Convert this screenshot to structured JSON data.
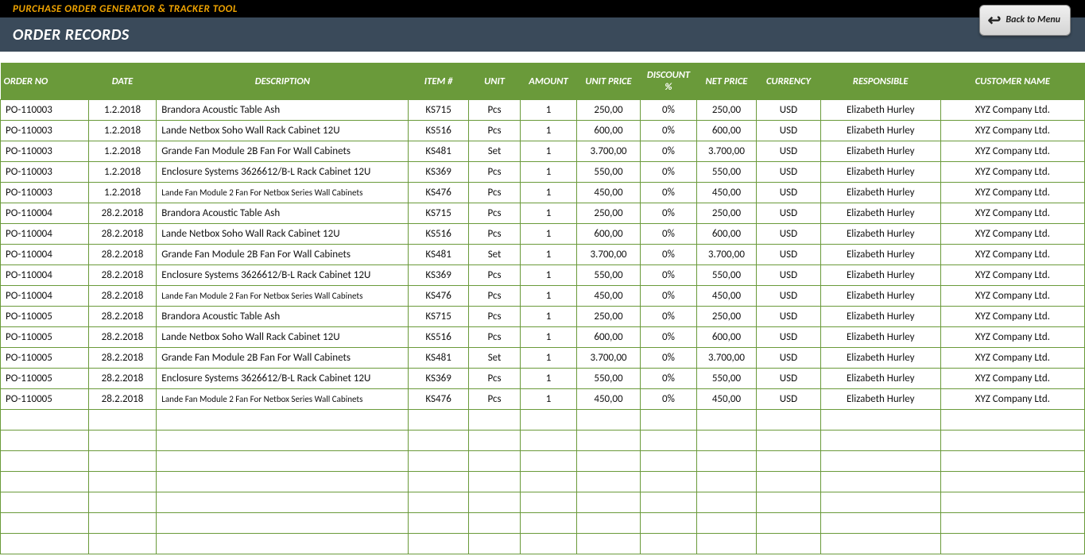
{
  "header": {
    "app_title": "PURCHASE ORDER GENERATOR & TRACKER TOOL",
    "page_title": "ORDER RECORDS",
    "back_label": "Back to Menu"
  },
  "columns": [
    "ORDER NO",
    "DATE",
    "DESCRIPTION",
    "ITEM #",
    "UNIT",
    "AMOUNT",
    "UNIT PRICE",
    "DISCOUNT %",
    "NET PRICE",
    "CURRENCY",
    "RESPONSIBLE",
    "CUSTOMER NAME"
  ],
  "rows": [
    {
      "order": "PO-110003",
      "date": "1.2.2018",
      "desc": "Brandora Acoustic Table Ash",
      "item": "KS715",
      "unit": "Pcs",
      "amount": "1",
      "uprice": "250,00",
      "disc": "0%",
      "nprice": "250,00",
      "curr": "USD",
      "resp": "Elizabeth Hurley",
      "cust": "XYZ Company Ltd.",
      "small": false
    },
    {
      "order": "PO-110003",
      "date": "1.2.2018",
      "desc": "Lande Netbox Soho Wall Rack Cabinet 12U",
      "item": "KS516",
      "unit": "Pcs",
      "amount": "1",
      "uprice": "600,00",
      "disc": "0%",
      "nprice": "600,00",
      "curr": "USD",
      "resp": "Elizabeth Hurley",
      "cust": "XYZ Company Ltd.",
      "small": false
    },
    {
      "order": "PO-110003",
      "date": "1.2.2018",
      "desc": "Grande Fan Module 2B Fan For Wall Cabinets",
      "item": "KS481",
      "unit": "Set",
      "amount": "1",
      "uprice": "3.700,00",
      "disc": "0%",
      "nprice": "3.700,00",
      "curr": "USD",
      "resp": "Elizabeth Hurley",
      "cust": "XYZ Company Ltd.",
      "small": false
    },
    {
      "order": "PO-110003",
      "date": "1.2.2018",
      "desc": "Enclosure Systems 3626612/B-L Rack Cabinet 12U",
      "item": "KS369",
      "unit": "Pcs",
      "amount": "1",
      "uprice": "550,00",
      "disc": "0%",
      "nprice": "550,00",
      "curr": "USD",
      "resp": "Elizabeth Hurley",
      "cust": "XYZ Company Ltd.",
      "small": false
    },
    {
      "order": "PO-110003",
      "date": "1.2.2018",
      "desc": "Lande Fan Module 2 Fan For Netbox Series Wall Cabinets",
      "item": "KS476",
      "unit": "Pcs",
      "amount": "1",
      "uprice": "450,00",
      "disc": "0%",
      "nprice": "450,00",
      "curr": "USD",
      "resp": "Elizabeth Hurley",
      "cust": "XYZ Company Ltd.",
      "small": true
    },
    {
      "order": "PO-110004",
      "date": "28.2.2018",
      "desc": "Brandora Acoustic Table Ash",
      "item": "KS715",
      "unit": "Pcs",
      "amount": "1",
      "uprice": "250,00",
      "disc": "0%",
      "nprice": "250,00",
      "curr": "USD",
      "resp": "Elizabeth Hurley",
      "cust": "XYZ Company Ltd.",
      "small": false
    },
    {
      "order": "PO-110004",
      "date": "28.2.2018",
      "desc": "Lande Netbox Soho Wall Rack Cabinet 12U",
      "item": "KS516",
      "unit": "Pcs",
      "amount": "1",
      "uprice": "600,00",
      "disc": "0%",
      "nprice": "600,00",
      "curr": "USD",
      "resp": "Elizabeth Hurley",
      "cust": "XYZ Company Ltd.",
      "small": false
    },
    {
      "order": "PO-110004",
      "date": "28.2.2018",
      "desc": "Grande Fan Module 2B Fan For Wall Cabinets",
      "item": "KS481",
      "unit": "Set",
      "amount": "1",
      "uprice": "3.700,00",
      "disc": "0%",
      "nprice": "3.700,00",
      "curr": "USD",
      "resp": "Elizabeth Hurley",
      "cust": "XYZ Company Ltd.",
      "small": false
    },
    {
      "order": "PO-110004",
      "date": "28.2.2018",
      "desc": "Enclosure Systems 3626612/B-L Rack Cabinet 12U",
      "item": "KS369",
      "unit": "Pcs",
      "amount": "1",
      "uprice": "550,00",
      "disc": "0%",
      "nprice": "550,00",
      "curr": "USD",
      "resp": "Elizabeth Hurley",
      "cust": "XYZ Company Ltd.",
      "small": false
    },
    {
      "order": "PO-110004",
      "date": "28.2.2018",
      "desc": "Lande Fan Module 2 Fan For Netbox Series Wall Cabinets",
      "item": "KS476",
      "unit": "Pcs",
      "amount": "1",
      "uprice": "450,00",
      "disc": "0%",
      "nprice": "450,00",
      "curr": "USD",
      "resp": "Elizabeth Hurley",
      "cust": "XYZ Company Ltd.",
      "small": true
    },
    {
      "order": "PO-110005",
      "date": "28.2.2018",
      "desc": "Brandora Acoustic Table Ash",
      "item": "KS715",
      "unit": "Pcs",
      "amount": "1",
      "uprice": "250,00",
      "disc": "0%",
      "nprice": "250,00",
      "curr": "USD",
      "resp": "Elizabeth Hurley",
      "cust": "XYZ Company Ltd.",
      "small": false
    },
    {
      "order": "PO-110005",
      "date": "28.2.2018",
      "desc": "Lande Netbox Soho Wall Rack Cabinet 12U",
      "item": "KS516",
      "unit": "Pcs",
      "amount": "1",
      "uprice": "600,00",
      "disc": "0%",
      "nprice": "600,00",
      "curr": "USD",
      "resp": "Elizabeth Hurley",
      "cust": "XYZ Company Ltd.",
      "small": false
    },
    {
      "order": "PO-110005",
      "date": "28.2.2018",
      "desc": "Grande Fan Module 2B Fan For Wall Cabinets",
      "item": "KS481",
      "unit": "Set",
      "amount": "1",
      "uprice": "3.700,00",
      "disc": "0%",
      "nprice": "3.700,00",
      "curr": "USD",
      "resp": "Elizabeth Hurley",
      "cust": "XYZ Company Ltd.",
      "small": false
    },
    {
      "order": "PO-110005",
      "date": "28.2.2018",
      "desc": "Enclosure Systems 3626612/B-L Rack Cabinet 12U",
      "item": "KS369",
      "unit": "Pcs",
      "amount": "1",
      "uprice": "550,00",
      "disc": "0%",
      "nprice": "550,00",
      "curr": "USD",
      "resp": "Elizabeth Hurley",
      "cust": "XYZ Company Ltd.",
      "small": false
    },
    {
      "order": "PO-110005",
      "date": "28.2.2018",
      "desc": "Lande Fan Module 2 Fan For Netbox Series Wall Cabinets",
      "item": "KS476",
      "unit": "Pcs",
      "amount": "1",
      "uprice": "450,00",
      "disc": "0%",
      "nprice": "450,00",
      "curr": "USD",
      "resp": "Elizabeth Hurley",
      "cust": "XYZ Company Ltd.",
      "small": true
    }
  ],
  "empty_rows": 7
}
